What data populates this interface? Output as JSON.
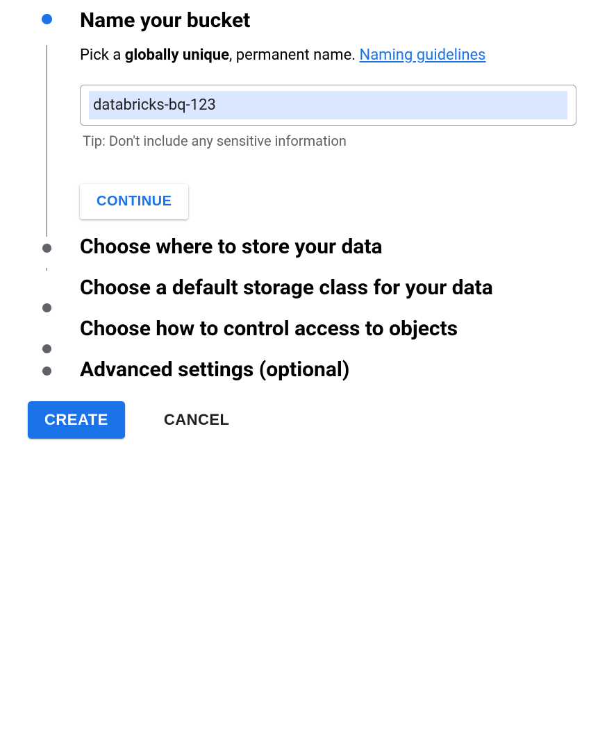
{
  "steps": {
    "name": {
      "title": "Name your bucket",
      "subtitle_prefix": "Pick a ",
      "subtitle_bold": "globally unique",
      "subtitle_suffix": ", permanent name. ",
      "link_text": "Naming guidelines",
      "input_value": "databricks-bq-123",
      "tip": "Tip: Don't include any sensitive information",
      "continue_label": "CONTINUE"
    },
    "location": {
      "title": "Choose where to store your data"
    },
    "storage_class": {
      "title": "Choose a default storage class for your data"
    },
    "access": {
      "title": "Choose how to control access to objects"
    },
    "advanced": {
      "title": "Advanced settings (optional)"
    }
  },
  "footer": {
    "create_label": "CREATE",
    "cancel_label": "CANCEL"
  }
}
